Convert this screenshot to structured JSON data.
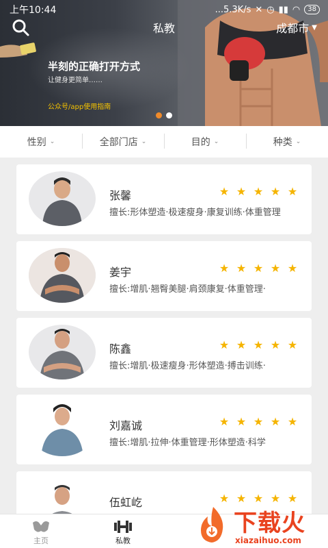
{
  "status_bar": {
    "time": "上午10:44",
    "net_speed": "...5.3K/s",
    "battery": "38"
  },
  "header": {
    "title": "私教",
    "city": "成都市"
  },
  "banner": {
    "headline": "半刻的正确打开方式",
    "subline": "让健身更简单……",
    "link_text": "公众号/app使用指南",
    "page_count": 2,
    "active_page": 1
  },
  "filters": [
    {
      "label": "性别"
    },
    {
      "label": "全部门店"
    },
    {
      "label": "目的"
    },
    {
      "label": "种类"
    }
  ],
  "coaches": [
    {
      "name": "张馨",
      "rating": 5,
      "specialty": "擅长:形体塑造·极速瘦身·康复训练·体重管理"
    },
    {
      "name": "姜宇",
      "rating": 5,
      "specialty": "擅长:增肌·翘臀美腿·肩颈康复·体重管理·"
    },
    {
      "name": "陈鑫",
      "rating": 5,
      "specialty": "擅长:增肌·极速瘦身·形体塑造·搏击训练·"
    },
    {
      "name": "刘嘉诚",
      "rating": 5,
      "specialty": "擅长:增肌·拉伸·体重管理·形体塑造·科学"
    },
    {
      "name": "伍虹屹",
      "rating": 5,
      "specialty": ""
    }
  ],
  "tab_bar": {
    "tabs": [
      {
        "label": "主页",
        "active": false
      },
      {
        "label": "私教",
        "active": true
      }
    ]
  },
  "watermark": {
    "brand": "下载火",
    "url": "xiazaihuo.com"
  },
  "colors": {
    "accent": "#f08a2a",
    "star": "#f5b400",
    "watermark": "#e9431f"
  }
}
